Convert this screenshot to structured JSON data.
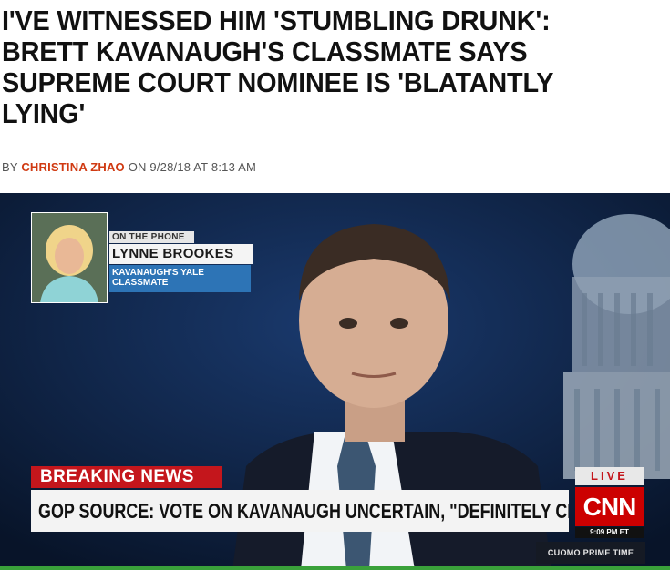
{
  "article": {
    "headline": "I'VE WITNESSED HIM 'STUMBLING DRUNK': BRETT KAVANAUGH'S CLASSMATE SAYS SUPREME COURT NOMINEE IS 'BLATANTLY LYING'",
    "byline_prefix": "BY",
    "author": "CHRISTINA ZHAO",
    "date_prefix": "ON",
    "date": "9/28/18 AT 8:13 AM"
  },
  "video": {
    "phone_label": "ON THE PHONE",
    "caller_name": "LYNNE BROOKES",
    "caller_desc": "KAVANAUGH'S YALE CLASSMATE",
    "breaking_label": "BREAKING NEWS",
    "ticker": "GOP SOURCE: VOTE ON KAVANAUGH UNCERTAIN, \"DEFINITELY CLOSE\"",
    "live_label": "LIVE",
    "network_logo": "CNN",
    "clock": "9:09 PM ET",
    "show_name": "CUOMO PRIME TIME"
  },
  "colors": {
    "author": "#d03a12",
    "breaking": "#c4161c",
    "network": "#cc0000",
    "caller_desc_bg": "#2d74b6"
  }
}
